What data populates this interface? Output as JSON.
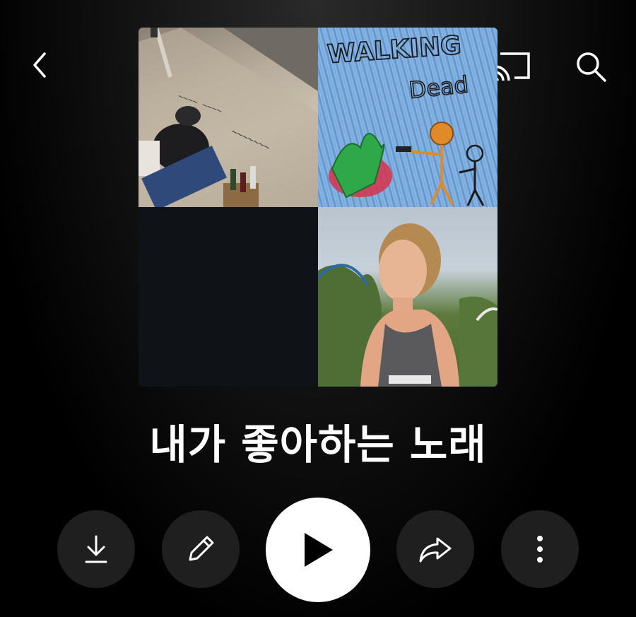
{
  "playlist": {
    "title": "내가 좋아하는 노래"
  },
  "cover": {
    "drawing_text_line1": "WALKING",
    "drawing_text_line2": "Dead"
  },
  "icons": {
    "back": "chevron-left-icon",
    "cast": "cast-icon",
    "search": "search-icon",
    "download": "download-icon",
    "edit": "pencil-icon",
    "play": "play-icon",
    "share": "share-arrow-icon",
    "more": "more-vertical-icon"
  },
  "colors": {
    "background": "#000000",
    "button_bg": "#1f1f1f",
    "play_bg": "#ffffff",
    "text": "#ffffff"
  }
}
